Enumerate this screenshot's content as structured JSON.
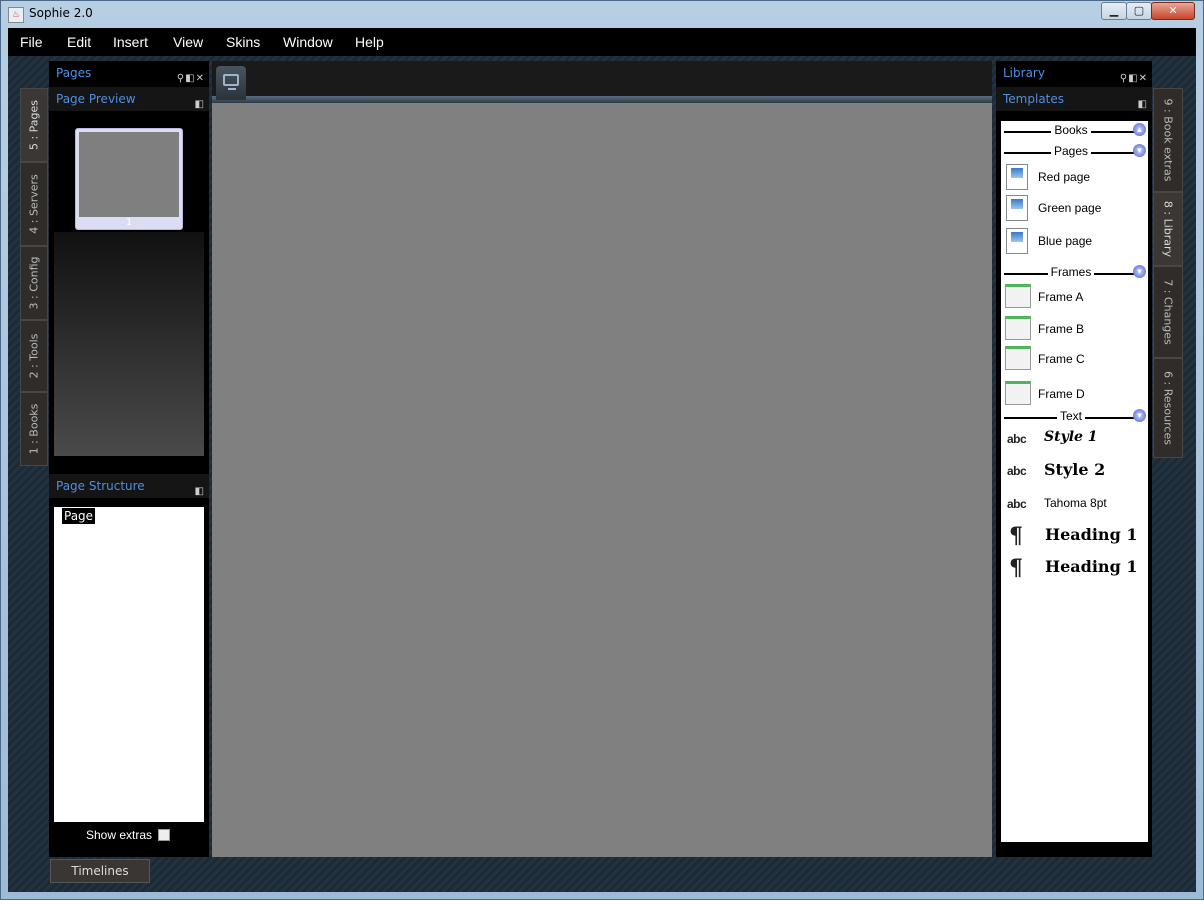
{
  "window": {
    "title": "Sophie 2.0",
    "icon": "java-icon"
  },
  "menu": [
    "File",
    "Edit",
    "Insert",
    "View",
    "Skins",
    "Window",
    "Help"
  ],
  "left_tabs": [
    "5 : Pages",
    "4 : Servers",
    "3 : Config",
    "2 : Tools",
    "1 : Books"
  ],
  "right_tabs": [
    "9 : Book extras",
    "8 : Library",
    "7 : Changes",
    "6 : Resources"
  ],
  "pages_panel": {
    "title": "Pages",
    "preview_title": "Page Preview",
    "thumb_number": "1",
    "structure_title": "Page Structure",
    "structure_item": "Page",
    "show_extras": "Show extras"
  },
  "library_panel": {
    "title": "Library",
    "templates_title": "Templates",
    "sections": {
      "books": "Books",
      "pages": "Pages",
      "frames": "Frames",
      "text": "Text"
    },
    "page_items": [
      "Red page",
      "Green page",
      "Blue page"
    ],
    "frame_items": [
      "Frame A",
      "Frame B",
      "Frame C",
      "Frame D"
    ],
    "text_items": [
      {
        "icon": "abc",
        "label": "Style 1"
      },
      {
        "icon": "abc",
        "label": "Style 2"
      },
      {
        "icon": "abc",
        "label": "Tahoma 8pt"
      },
      {
        "icon": "¶",
        "label": "Heading 1"
      },
      {
        "icon": "¶",
        "label": "Heading 1"
      }
    ]
  },
  "bottom_tab": "Timelines",
  "colors": {
    "panel_title": "#4f8fe0",
    "canvas": "#808080",
    "accent": "#4a5fd0"
  }
}
